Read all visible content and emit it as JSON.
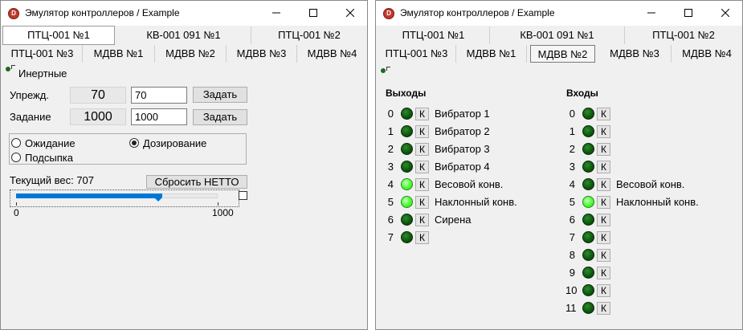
{
  "window_left": {
    "title": "Эмулятор контроллеров / Example",
    "tabs_row1": [
      "ПТЦ-001 №1",
      "КВ-001 091 №1",
      "ПТЦ-001 №2"
    ],
    "tabs_row2": [
      "ПТЦ-001 №3",
      "МДВВ №1",
      "МДВВ №2",
      "МДВВ №3",
      "МДВВ №4"
    ],
    "active_tab": "ПТЦ-001 №1",
    "inert_label": "Инертные",
    "warn_label": "Упрежд.",
    "warn_display": "70",
    "warn_input": "70",
    "set_label": "Задание",
    "set_display": "1000",
    "set_input": "1000",
    "apply_button": "Задать",
    "modes": [
      {
        "label": "Ожидание",
        "checked": false
      },
      {
        "label": "Дозирование",
        "checked": true
      },
      {
        "label": "Подсыпка",
        "checked": false
      }
    ],
    "current_weight_label": "Текущий вес: 707",
    "reset_net_button": "Сбросить НЕТТО",
    "slider": {
      "min": 0,
      "max": 1000,
      "value": 707,
      "min_label": "0",
      "max_label": "1000"
    }
  },
  "window_right": {
    "title": "Эмулятор контроллеров / Example",
    "tabs_row1": [
      "ПТЦ-001 №1",
      "КВ-001 091 №1",
      "ПТЦ-001 №2"
    ],
    "tabs_row2": [
      "ПТЦ-001 №3",
      "МДВВ №1",
      "МДВВ №2",
      "МДВВ №3",
      "МДВВ №4"
    ],
    "active_tab": "МДВВ №2",
    "k_label": "К",
    "outputs_header": "Выходы",
    "inputs_header": "Входы",
    "outputs": [
      {
        "num": "0",
        "on": false,
        "label": "Вибратор 1"
      },
      {
        "num": "1",
        "on": false,
        "label": "Вибратор 2"
      },
      {
        "num": "2",
        "on": false,
        "label": "Вибратор 3"
      },
      {
        "num": "3",
        "on": false,
        "label": "Вибратор 4"
      },
      {
        "num": "4",
        "on": true,
        "label": "Весовой конв."
      },
      {
        "num": "5",
        "on": true,
        "label": "Наклонный конв."
      },
      {
        "num": "6",
        "on": false,
        "label": "Сирена"
      },
      {
        "num": "7",
        "on": false,
        "label": ""
      }
    ],
    "inputs": [
      {
        "num": "0",
        "on": false,
        "label": ""
      },
      {
        "num": "1",
        "on": false,
        "label": ""
      },
      {
        "num": "2",
        "on": false,
        "label": ""
      },
      {
        "num": "3",
        "on": false,
        "label": ""
      },
      {
        "num": "4",
        "on": false,
        "label": "Весовой конв."
      },
      {
        "num": "5",
        "on": true,
        "label": "Наклонный конв."
      },
      {
        "num": "6",
        "on": false,
        "label": ""
      },
      {
        "num": "7",
        "on": false,
        "label": ""
      },
      {
        "num": "8",
        "on": false,
        "label": ""
      },
      {
        "num": "9",
        "on": false,
        "label": ""
      },
      {
        "num": "10",
        "on": false,
        "label": ""
      },
      {
        "num": "11",
        "on": false,
        "label": ""
      }
    ]
  }
}
